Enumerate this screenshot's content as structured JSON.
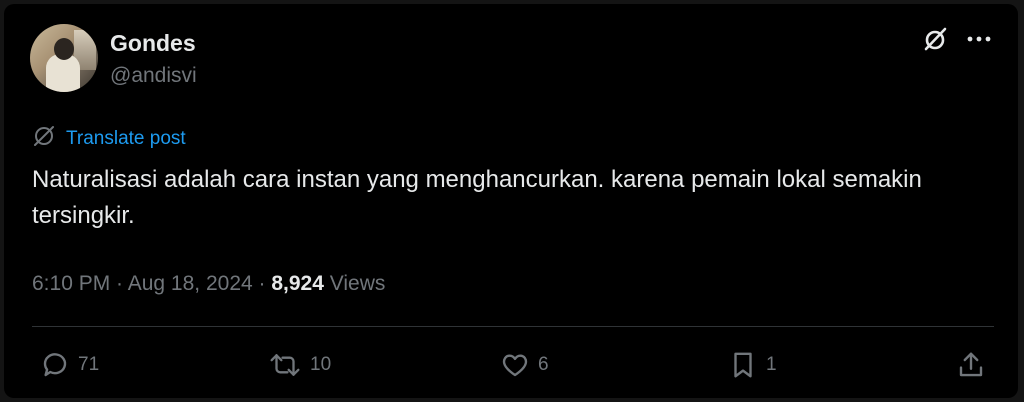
{
  "author": {
    "name": "Gondes",
    "handle": "@andisvi"
  },
  "header_icons": [
    "grok-icon",
    "more-icon"
  ],
  "translate": {
    "icon": "globe-slash-icon",
    "label": "Translate post"
  },
  "post": {
    "text": "Naturalisasi adalah cara instan yang menghancurkan. karena pemain lokal semakin tersingkir."
  },
  "meta": {
    "time": "6:10 PM",
    "separator1": " · ",
    "date": "Aug 18, 2024",
    "separator2": " · ",
    "views_count": "8,924",
    "views_label": " Views"
  },
  "actions": {
    "replies": "71",
    "reposts": "10",
    "likes": "6",
    "bookmarks": "1"
  },
  "colors": {
    "background": "#000000",
    "text_primary": "#e7e9ea",
    "text_secondary": "#71767b",
    "link": "#1d9bf0",
    "divider": "#2f3336"
  }
}
